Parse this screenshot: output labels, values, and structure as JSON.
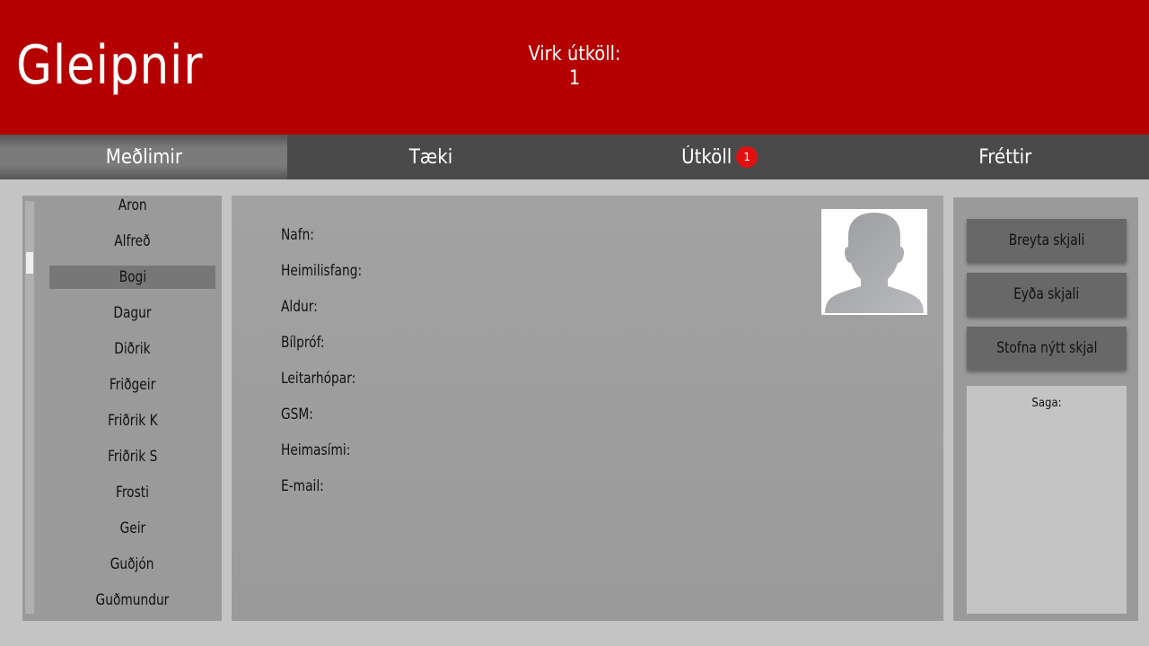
{
  "header": {
    "app_title": "Gleipnir",
    "active_calls_label": "Virk útköll:",
    "active_calls_count": "1"
  },
  "nav": {
    "tabs": [
      {
        "label": "Meðlimir",
        "active": true
      },
      {
        "label": "Tæki",
        "active": false
      },
      {
        "label": "Útköll",
        "active": false,
        "badge": "1"
      },
      {
        "label": "Fréttir",
        "active": false
      }
    ]
  },
  "members": {
    "items": [
      "Aron",
      "Alfreð",
      "Bogi",
      "Dagur",
      "Diðrik",
      "Friðgeir",
      "Friðrik K",
      "Friðrik S",
      "Frosti",
      "Geir",
      "Guðjón",
      "Guðmundur"
    ],
    "selected": "Bogi"
  },
  "details": {
    "fields": [
      "Nafn:",
      "Heimilisfang:",
      "Aldur:",
      "Bílpróf:",
      "Leitarhópar:",
      "GSM:",
      "Heimasími:",
      "E-mail:"
    ],
    "avatar_icon": "person-silhouette-icon"
  },
  "actions": {
    "edit_label": "Breyta skjali",
    "delete_label": "Eyða skjali",
    "create_label": "Stofna nýtt skjal",
    "history_label": "Saga:"
  },
  "colors": {
    "header_bg": "#b50000",
    "nav_bg": "#4a4a4a",
    "badge_bg": "#e01010",
    "selected_item_bg": "#777777"
  }
}
